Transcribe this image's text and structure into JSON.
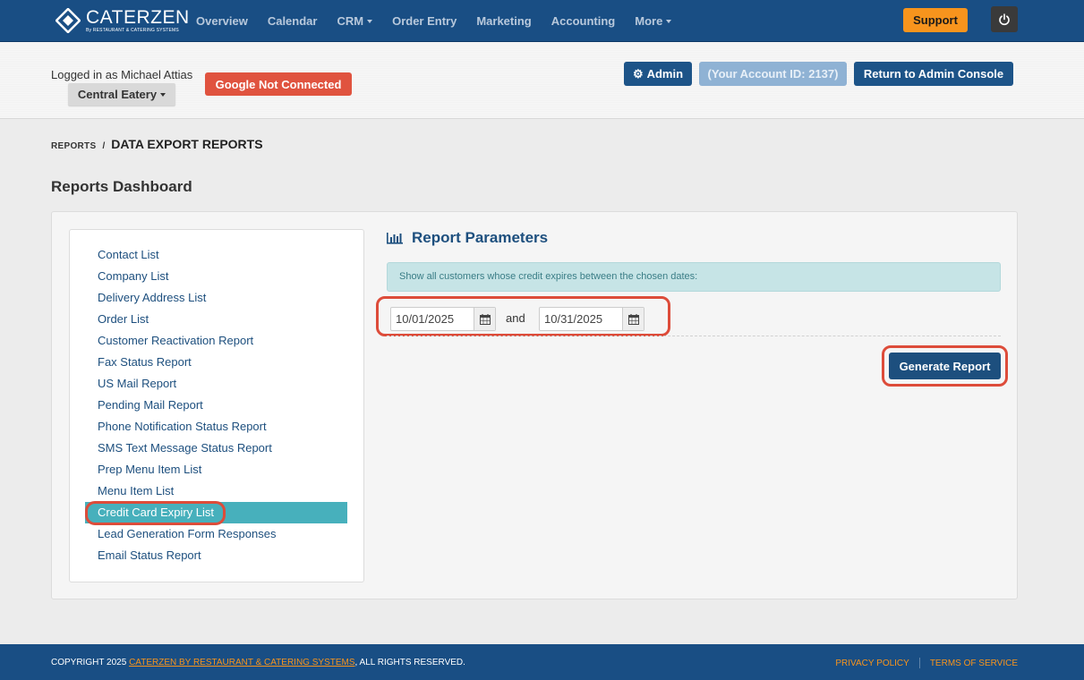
{
  "brand": {
    "name": "CATERZEN",
    "tagline": "By RESTAURANT & CATERING SYSTEMS"
  },
  "nav": {
    "items": [
      {
        "label": "Overview",
        "dropdown": false
      },
      {
        "label": "Calendar",
        "dropdown": false
      },
      {
        "label": "CRM",
        "dropdown": true
      },
      {
        "label": "Order Entry",
        "dropdown": false
      },
      {
        "label": "Marketing",
        "dropdown": false
      },
      {
        "label": "Accounting",
        "dropdown": false
      },
      {
        "label": "More",
        "dropdown": true
      }
    ],
    "support_label": "Support"
  },
  "account": {
    "logged_in_text": "Logged in as Michael Attias",
    "restaurant": "Central Eatery",
    "google_status": "Google Not Connected",
    "admin_label": "Admin",
    "account_id_text": "(Your Account ID: 2137)",
    "return_label": "Return to Admin Console"
  },
  "breadcrumb": {
    "parent": "REPORTS",
    "separator": "/",
    "current": "DATA EXPORT REPORTS"
  },
  "page_title": "Reports Dashboard",
  "reports": {
    "items": [
      "Contact List",
      "Company List",
      "Delivery Address List",
      "Order List",
      "Customer Reactivation Report",
      "Fax Status Report",
      "US Mail Report",
      "Pending Mail Report",
      "Phone Notification Status Report",
      "SMS Text Message Status Report",
      "Prep Menu Item List",
      "Menu Item List",
      "Credit Card Expiry List",
      "Lead Generation Form Responses",
      "Email Status Report"
    ],
    "active": "Credit Card Expiry List"
  },
  "params": {
    "title": "Report Parameters",
    "info": "Show all customers whose credit expires between the chosen dates:",
    "start_date": "10/01/2025",
    "connector": "and",
    "end_date": "10/31/2025",
    "generate_label": "Generate Report"
  },
  "footer": {
    "copyright_prefix": "COPYRIGHT 2025 ",
    "copyright_link": "CATERZEN BY RESTAURANT & CATERING SYSTEMS",
    "copyright_suffix": ", ALL RIGHTS RESERVED.",
    "privacy": "PRIVACY POLICY",
    "terms": "TERMS OF SERVICE"
  },
  "colors": {
    "navbar": "#194e84",
    "support": "#f7941d",
    "google_not_connected": "#e0533f",
    "primary_button": "#1d5488",
    "active_item": "#47b0bc",
    "highlight_outline": "#dd4c3a"
  }
}
